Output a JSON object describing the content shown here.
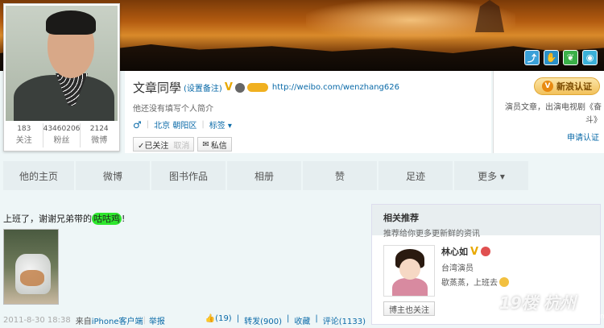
{
  "profile": {
    "name": "文章同學",
    "remark": "(设置备注)",
    "v_badge": "V",
    "url": "http://weibo.com/wenzhang626",
    "bio": "他还没有填写个人简介",
    "gender_symbol": "♂",
    "location": "北京 朝阳区",
    "tag_label": "标签 ▾",
    "follow_status": "✓已关注",
    "follow_cancel": "取消",
    "message_label": "私信"
  },
  "stats": [
    {
      "value": "183",
      "label": "关注"
    },
    {
      "value": "43460206",
      "label": "粉丝"
    },
    {
      "value": "2124",
      "label": "微博"
    }
  ],
  "banner_icons": [
    "link-icon",
    "hand-icon",
    "leaf-icon",
    "sina-icon"
  ],
  "auth": {
    "button_label": "新浪认证",
    "description": "演员文章，出演电视剧《奋斗》",
    "apply_link": "申请认证"
  },
  "nav": {
    "tabs": [
      "他的主页",
      "微博",
      "图书作品",
      "相册",
      "赞",
      "足迹",
      "更多 ▾"
    ]
  },
  "post": {
    "text_before": "上班了，谢谢兄弟带的",
    "highlight": "咕咕鸡",
    "text_after": "!",
    "time": "2011-8-30 18:38",
    "from_label": "来自",
    "source": "iPhone客户端",
    "report": "举报",
    "like": "👍(19)",
    "forward": "转发(900)",
    "favorite": "收藏",
    "comment": "评论(1133)"
  },
  "related": {
    "title": "相关推荐",
    "subtitle": "推荐给你更多更新鲜的资讯",
    "user_name": "林心如",
    "v_badge": "V",
    "role": "台湾演员",
    "latest_post": "歇蒸蒸，上班去",
    "follow_label": "博主也关注"
  },
  "watermark": {
    "brand": "19楼 杭州",
    "url": "www.19Lou.com"
  },
  "colors": {
    "link": "#0a6aa8",
    "highlight": "#2ee62e",
    "auth_gold": "#f2c15a",
    "v_gold": "#e8a800"
  }
}
